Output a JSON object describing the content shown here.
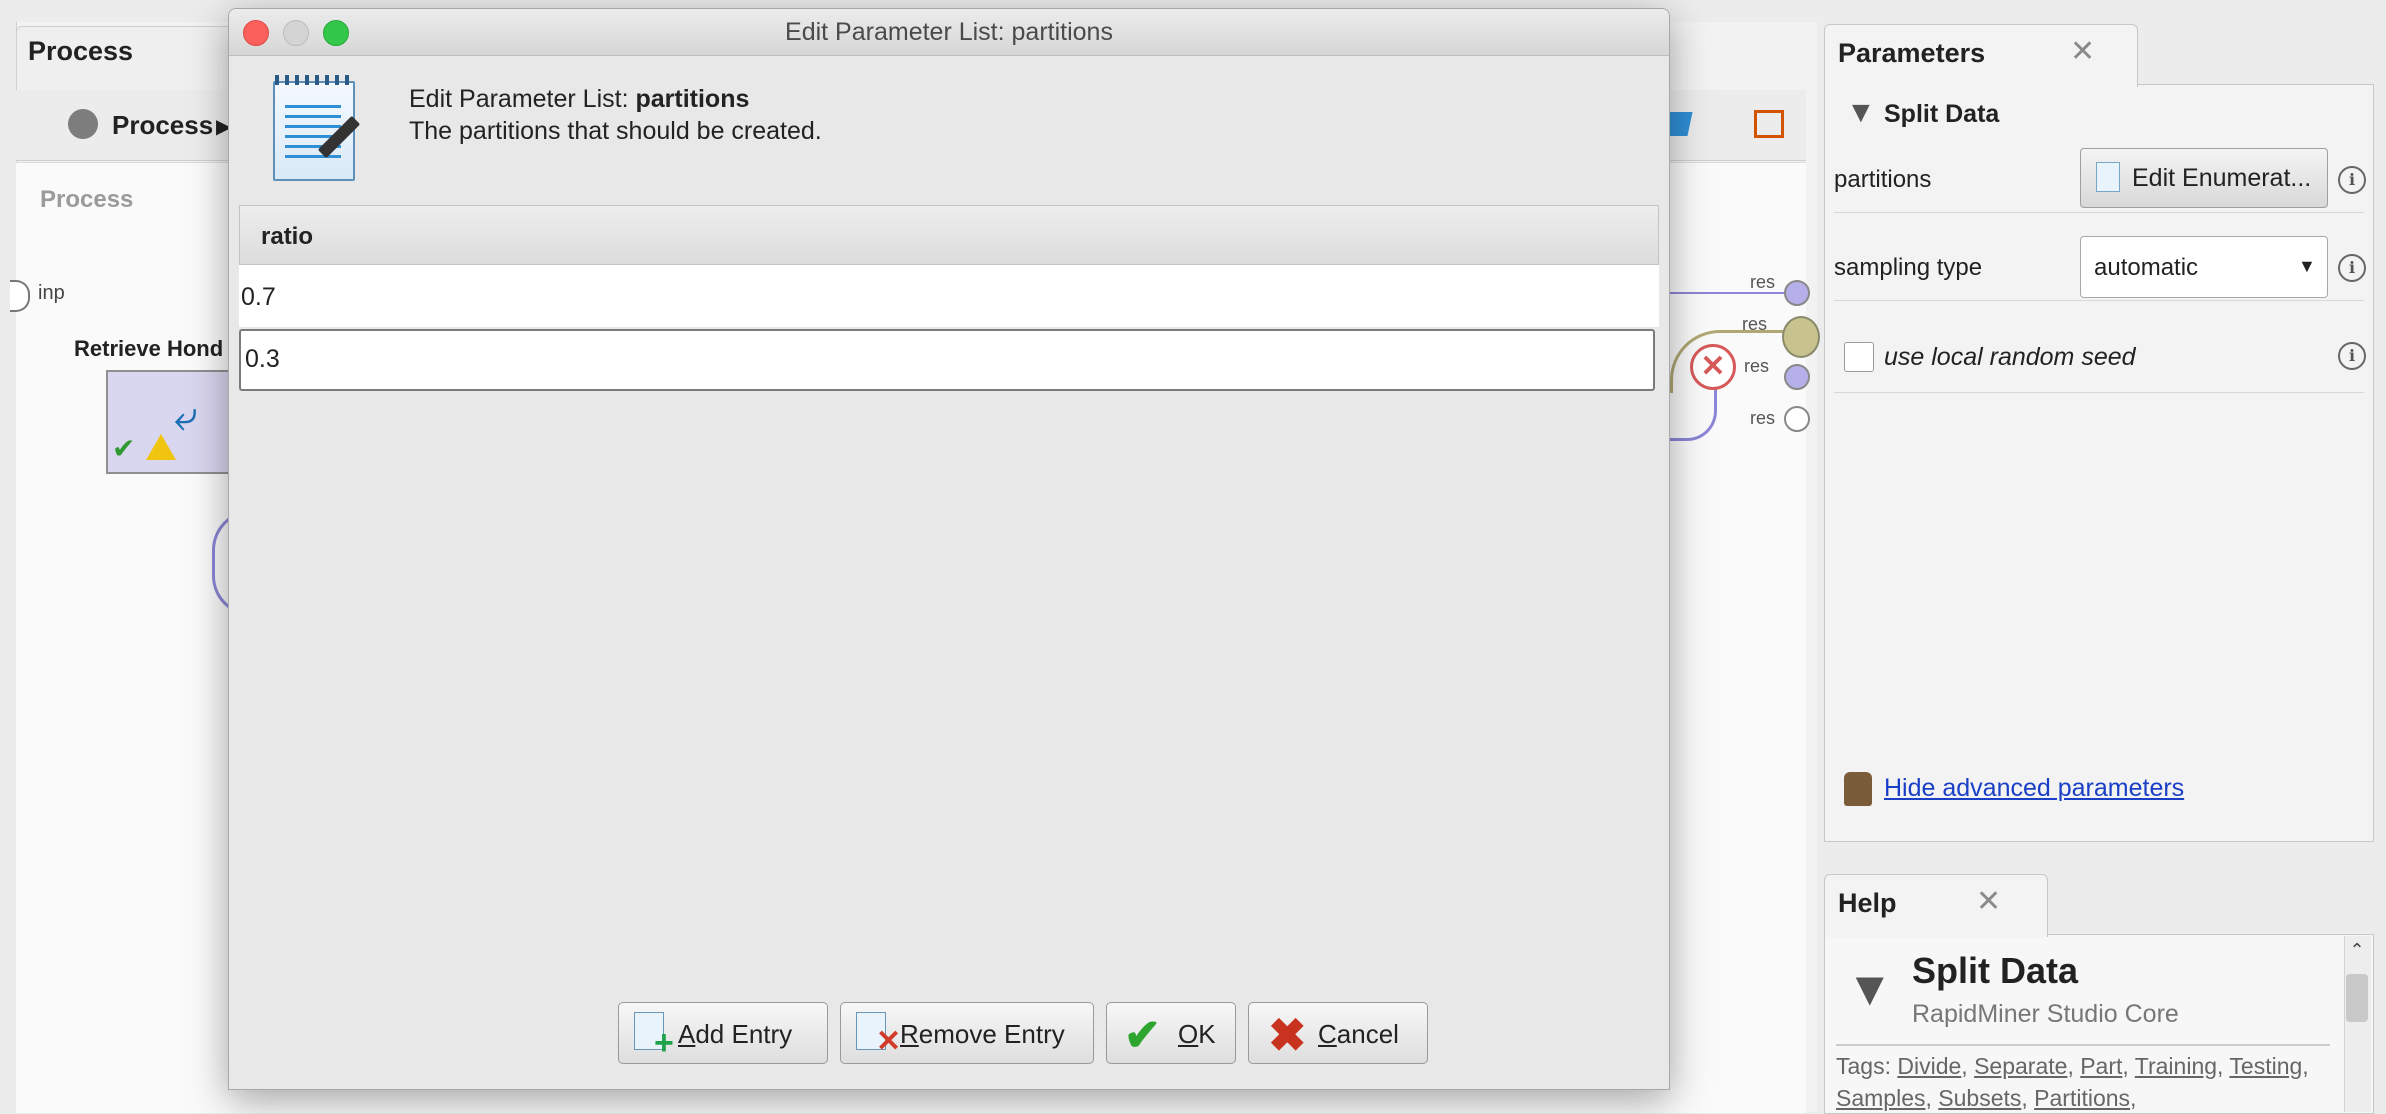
{
  "process_panel": {
    "tab_title": "Process",
    "breadcrumb": "Process",
    "canvas_title": "Process",
    "input_port": "inp",
    "operator_name": "Retrieve Hond",
    "result_ports": [
      "res",
      "res",
      "res",
      "res"
    ]
  },
  "dialog": {
    "window_title": "Edit Parameter List: partitions",
    "heading_prefix": "Edit Parameter List: ",
    "heading_name": "partitions",
    "description": "The partitions that should be created.",
    "table": {
      "columns": [
        "ratio"
      ],
      "rows": [
        [
          "0.7"
        ],
        [
          "0.3"
        ]
      ]
    },
    "buttons": {
      "add": {
        "underline": "A",
        "rest": "dd Entry"
      },
      "remove": {
        "underline": "R",
        "rest": "emove Entry"
      },
      "ok": {
        "underline": "O",
        "rest": "K"
      },
      "cancel": {
        "underline": "C",
        "rest": "ancel"
      }
    }
  },
  "parameters_panel": {
    "tab_title": "Parameters",
    "operator": "Split Data",
    "partitions_label": "partitions",
    "edit_button": "Edit Enumerat...",
    "sampling_label": "sampling type",
    "sampling_value": "automatic",
    "seed_label": "use local random seed",
    "seed_checked": false,
    "hide_advanced": "Hide advanced parameters"
  },
  "help_panel": {
    "tab_title": "Help",
    "operator": "Split Data",
    "source": "RapidMiner Studio Core",
    "tags_prefix": "Tags:",
    "tags": [
      "Divide",
      "Separate",
      "Part",
      "Training",
      "Testing",
      "Samples",
      "Subsets",
      "Partitions"
    ]
  },
  "icons": {
    "close": "close-icon",
    "info": "info-icon",
    "filter": "filter-icon",
    "error": "error-icon",
    "check": "check-icon",
    "warning": "warning-icon"
  },
  "colors": {
    "link": "#1a3fc7",
    "ok_green": "#2da52f",
    "cancel_red": "#c8331f",
    "operator_fill": "#d9d6ef"
  }
}
